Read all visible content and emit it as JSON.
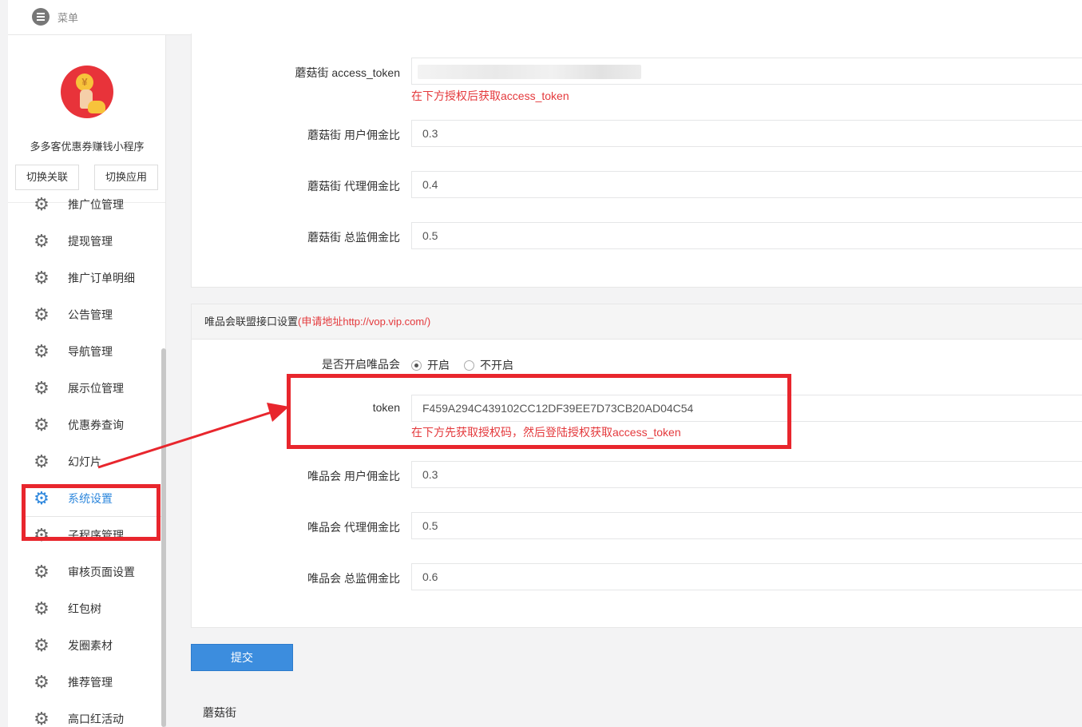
{
  "topbar": {
    "menu_label": "菜单"
  },
  "sidebar": {
    "app_name": "多多客优惠券赚钱小程序",
    "logo_symbol": "¥",
    "switch_link_label": "切换关联",
    "switch_app_label": "切换应用",
    "items": [
      {
        "label": "推广位管理"
      },
      {
        "label": "提现管理"
      },
      {
        "label": "推广订单明细"
      },
      {
        "label": "公告管理"
      },
      {
        "label": "导航管理"
      },
      {
        "label": "展示位管理"
      },
      {
        "label": "优惠券查询"
      },
      {
        "label": "幻灯片"
      },
      {
        "label": "系统设置",
        "active": true
      },
      {
        "label": "子程序管理"
      },
      {
        "label": "审核页面设置"
      },
      {
        "label": "红包树"
      },
      {
        "label": "发圈素材"
      },
      {
        "label": "推荐管理"
      },
      {
        "label": "高口红活动"
      }
    ]
  },
  "mogujie": {
    "access_token_label": "蘑菇街 access_token",
    "access_token_value": "",
    "access_token_hint": "在下方授权后获取access_token",
    "user_ratio_label": "蘑菇街 用户佣金比",
    "user_ratio_value": "0.3",
    "agent_ratio_label": "蘑菇街 代理佣金比",
    "agent_ratio_value": "0.4",
    "director_ratio_label": "蘑菇街 总监佣金比",
    "director_ratio_value": "0.5"
  },
  "vip": {
    "panel_title": "唯品会联盟接口设置",
    "apply_text": "(申请地址http://vop.vip.com/)",
    "enable_label": "是否开启唯品会",
    "enable_on": "开启",
    "enable_off": "不开启",
    "token_label": "token",
    "token_value": "F459A294C439102CC12DF39EE7D73CB20AD04C54",
    "token_hint": "在下方先获取授权码，然后登陆授权获取access_token",
    "user_ratio_label": "唯品会 用户佣金比",
    "user_ratio_value": "0.3",
    "agent_ratio_label": "唯品会 代理佣金比",
    "agent_ratio_value": "0.5",
    "director_ratio_label": "唯品会 总监佣金比",
    "director_ratio_value": "0.6"
  },
  "submit_label": "提交",
  "next_section_title": "蘑菇街",
  "colors": {
    "accent": "#3c8dde",
    "annotation_red": "#e8262d",
    "hint_red": "#e4393c",
    "active_nav": "#2f88dd"
  }
}
